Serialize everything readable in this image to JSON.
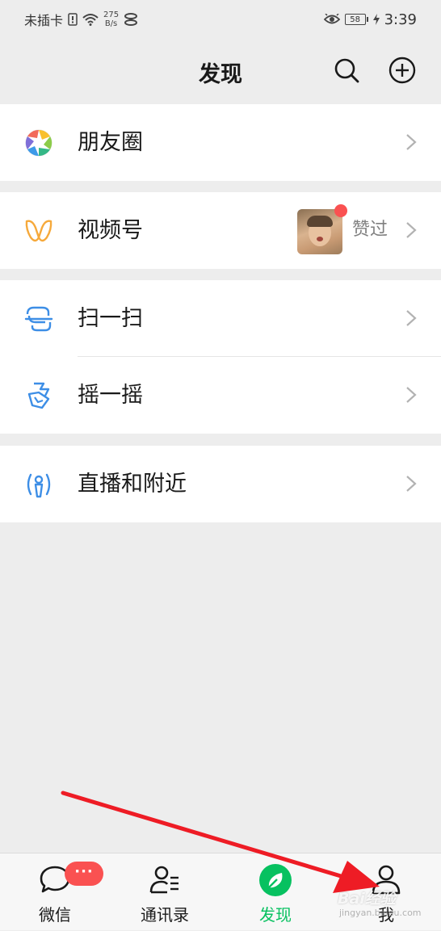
{
  "status_bar": {
    "carrier": "未插卡",
    "net_speed_value": "275",
    "net_speed_unit": "B/s",
    "battery": "58",
    "time": "3:39"
  },
  "header": {
    "title": "发现",
    "search_icon": "search-icon",
    "add_icon": "plus-circle-icon"
  },
  "menu": {
    "moments": {
      "label": "朋友圈",
      "icon": "aperture-icon"
    },
    "channels": {
      "label": "视频号",
      "icon": "channels-icon",
      "sub_text": "赞过",
      "has_red_dot": true
    },
    "scan": {
      "label": "扫一扫",
      "icon": "scan-icon"
    },
    "shake": {
      "label": "摇一摇",
      "icon": "shake-icon"
    },
    "live_nearby": {
      "label": "直播和附近",
      "icon": "live-nearby-icon"
    }
  },
  "tab_bar": {
    "tabs": [
      {
        "label": "微信",
        "icon": "chat-bubble-icon",
        "badge": "···",
        "active": false
      },
      {
        "label": "通讯录",
        "icon": "contacts-icon",
        "active": false
      },
      {
        "label": "发现",
        "icon": "compass-icon",
        "active": true
      },
      {
        "label": "我",
        "icon": "person-icon",
        "active": false
      }
    ]
  },
  "overlay": {
    "watermark_text": "Bai经验",
    "watermark_sub": "jingyan.baidu.com"
  },
  "colors": {
    "accent_green": "#07c160",
    "badge_red": "#fa5151",
    "annotation_arrow": "#ee1c25"
  }
}
